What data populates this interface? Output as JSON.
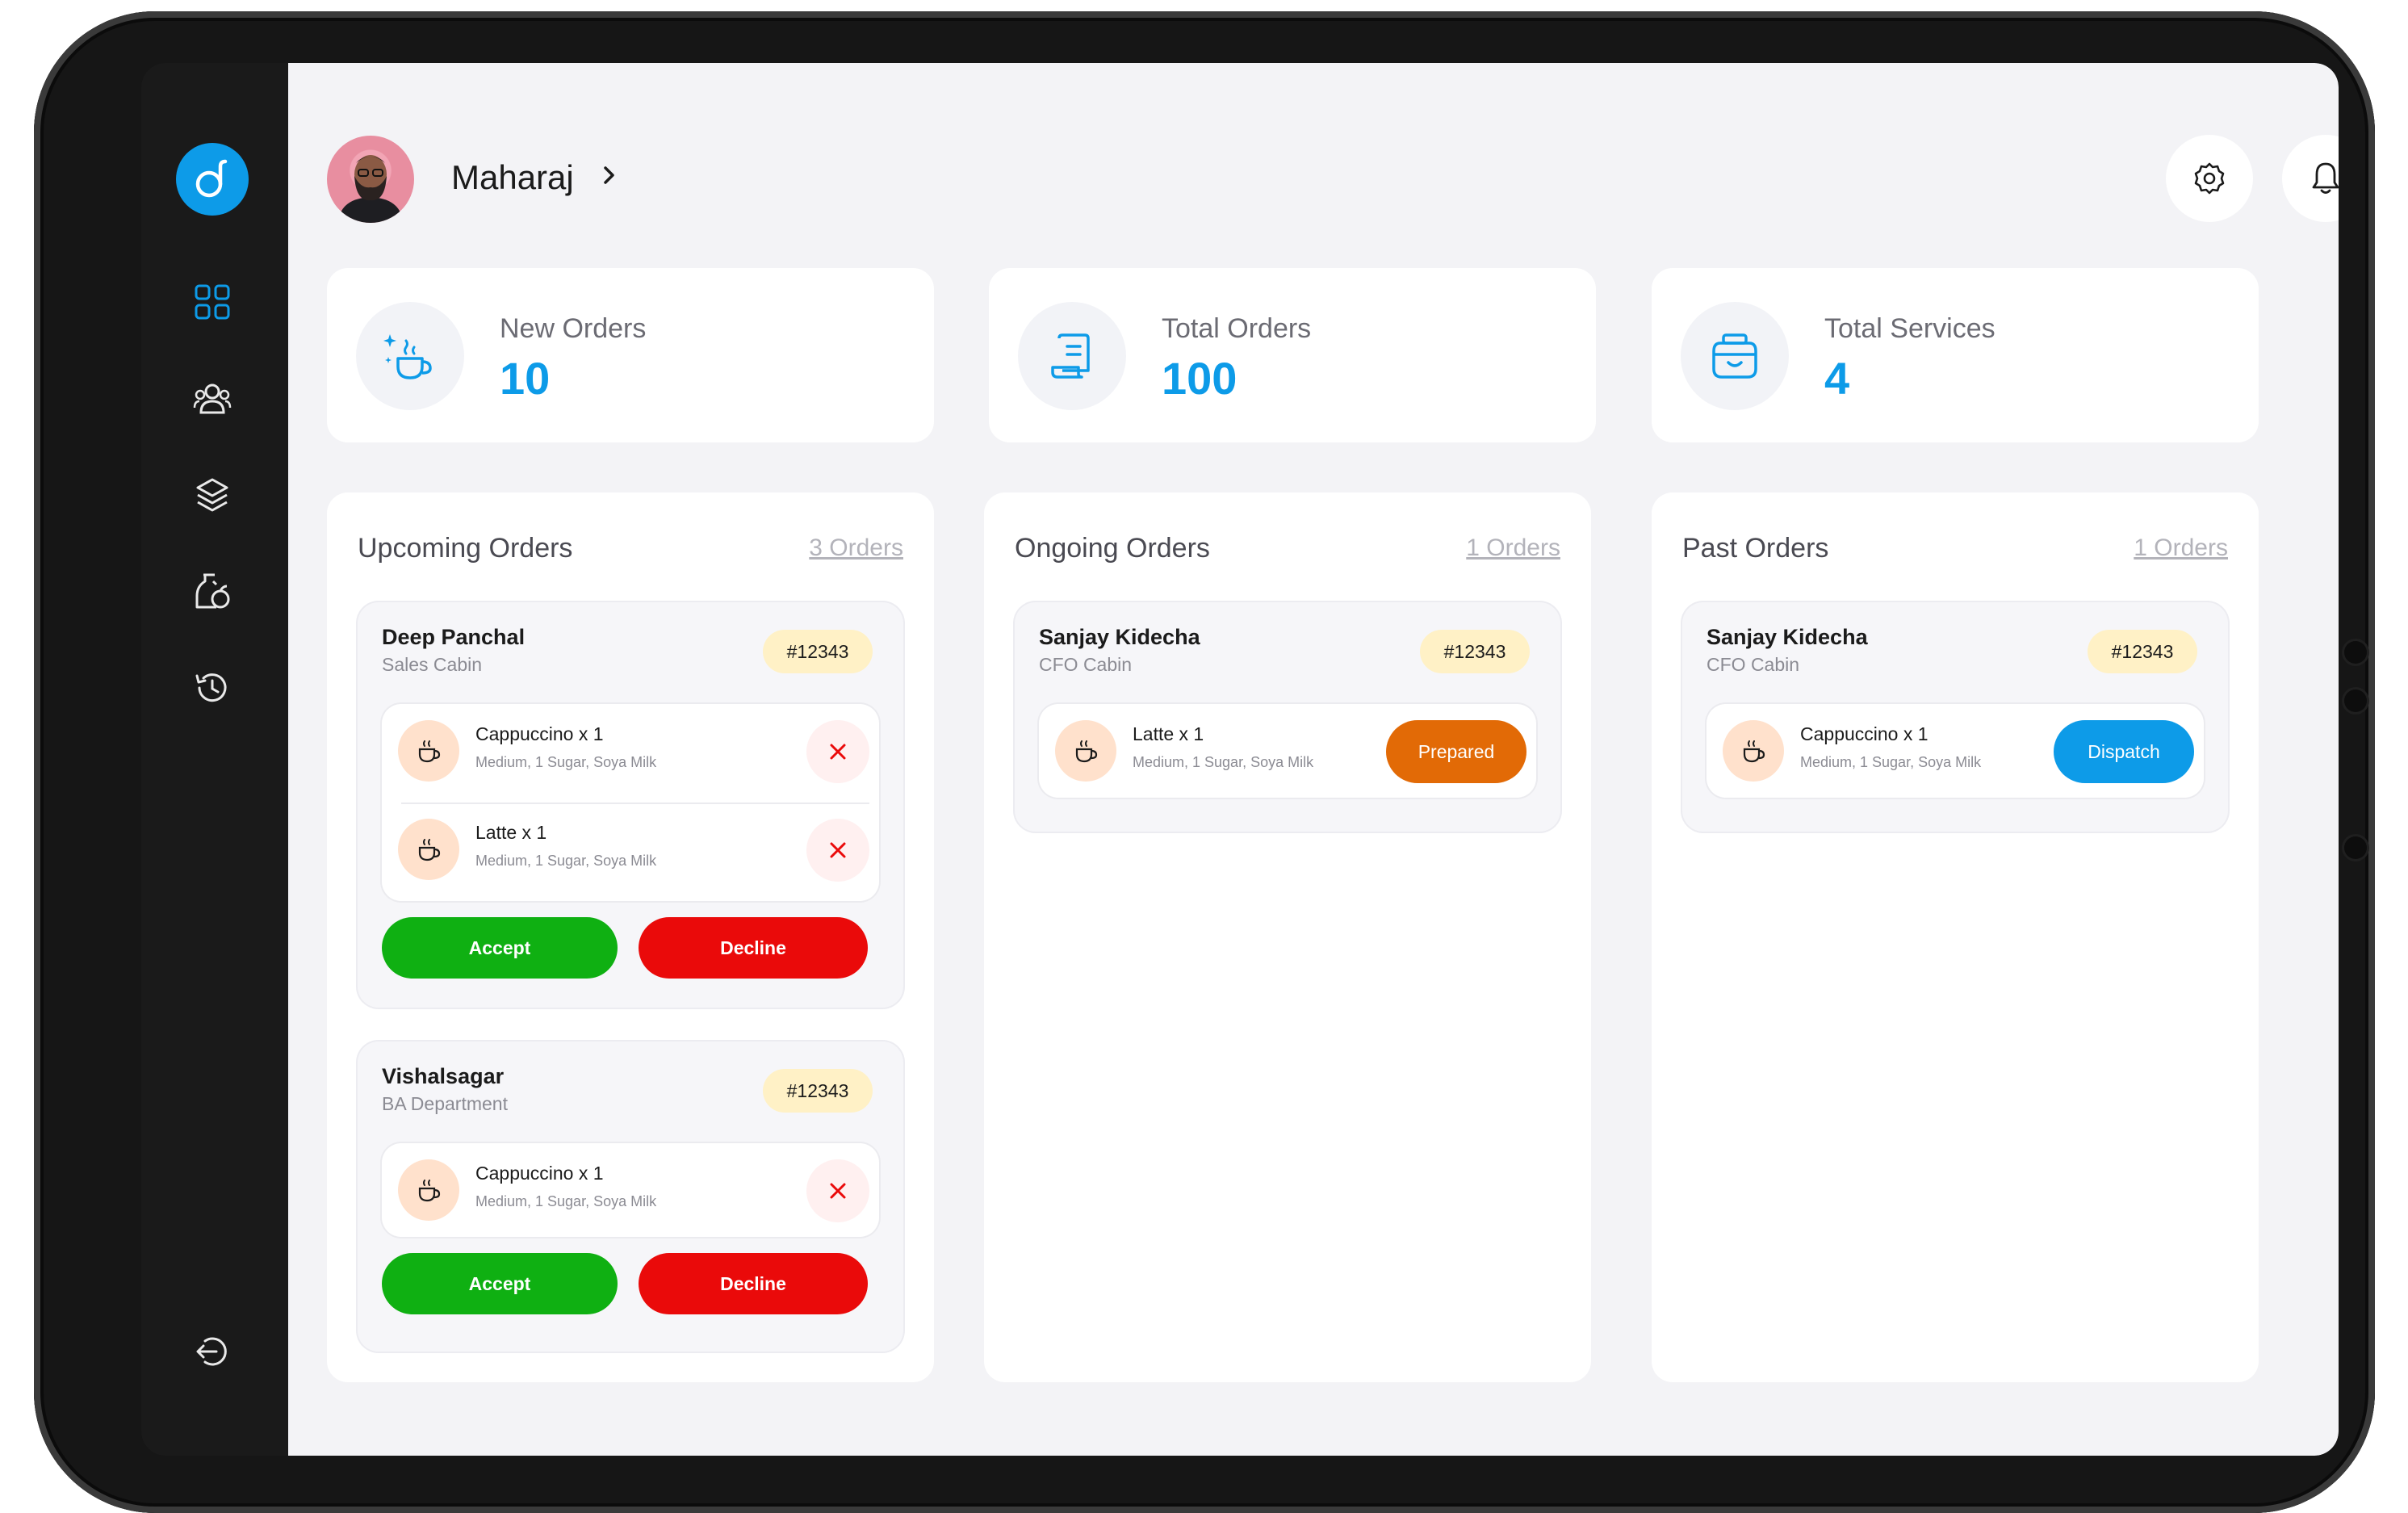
{
  "user": {
    "name": "Maharaj"
  },
  "stats": [
    {
      "label": "New Orders",
      "value": "10",
      "icon": "coffee-sparkle-icon"
    },
    {
      "label": "Total Orders",
      "value": "100",
      "icon": "receipt-icon"
    },
    {
      "label": "Total Services",
      "value": "4",
      "icon": "jar-icon"
    }
  ],
  "columns": {
    "upcoming": {
      "title": "Upcoming Orders",
      "count": "3 Orders",
      "orders": [
        {
          "customer": "Deep Panchal",
          "dept": "Sales Cabin",
          "id": "#12343",
          "items": [
            {
              "name": "Cappuccino x 1",
              "desc": "Medium,  1 Sugar, Soya Milk"
            },
            {
              "name": "Latte x 1",
              "desc": "Medium,  1 Sugar, Soya Milk"
            }
          ],
          "accept": "Accept",
          "decline": "Decline"
        },
        {
          "customer": "Vishalsagar",
          "dept": "BA Department",
          "id": "#12343",
          "items": [
            {
              "name": "Cappuccino x 1",
              "desc": "Medium,  1 Sugar, Soya Milk"
            }
          ],
          "accept": "Accept",
          "decline": "Decline"
        }
      ]
    },
    "ongoing": {
      "title": "Ongoing Orders",
      "count": "1 Orders",
      "orders": [
        {
          "customer": "Sanjay Kidecha",
          "dept": "CFO Cabin",
          "id": "#12343",
          "items": [
            {
              "name": "Latte x 1",
              "desc": "Medium,  1 Sugar, Soya Milk"
            }
          ],
          "status": "Prepared"
        }
      ]
    },
    "past": {
      "title": "Past Orders",
      "count": "1 Orders",
      "orders": [
        {
          "customer": "Sanjay Kidecha",
          "dept": "CFO Cabin",
          "id": "#12343",
          "items": [
            {
              "name": "Cappuccino x 1",
              "desc": "Medium,  1 Sugar, Soya Milk"
            }
          ],
          "status": "Dispatch"
        }
      ]
    }
  },
  "colors": {
    "brand": "#0d9be8",
    "accept": "#0fb012",
    "decline": "#ea0a0a",
    "prepared": "#e26a06",
    "dispatch": "#0d9be8",
    "badge": "#fff1c6"
  },
  "sidebar": {
    "icons": [
      "dashboard-icon",
      "users-icon",
      "layers-icon",
      "services-icon",
      "history-icon",
      "logout-icon"
    ]
  }
}
